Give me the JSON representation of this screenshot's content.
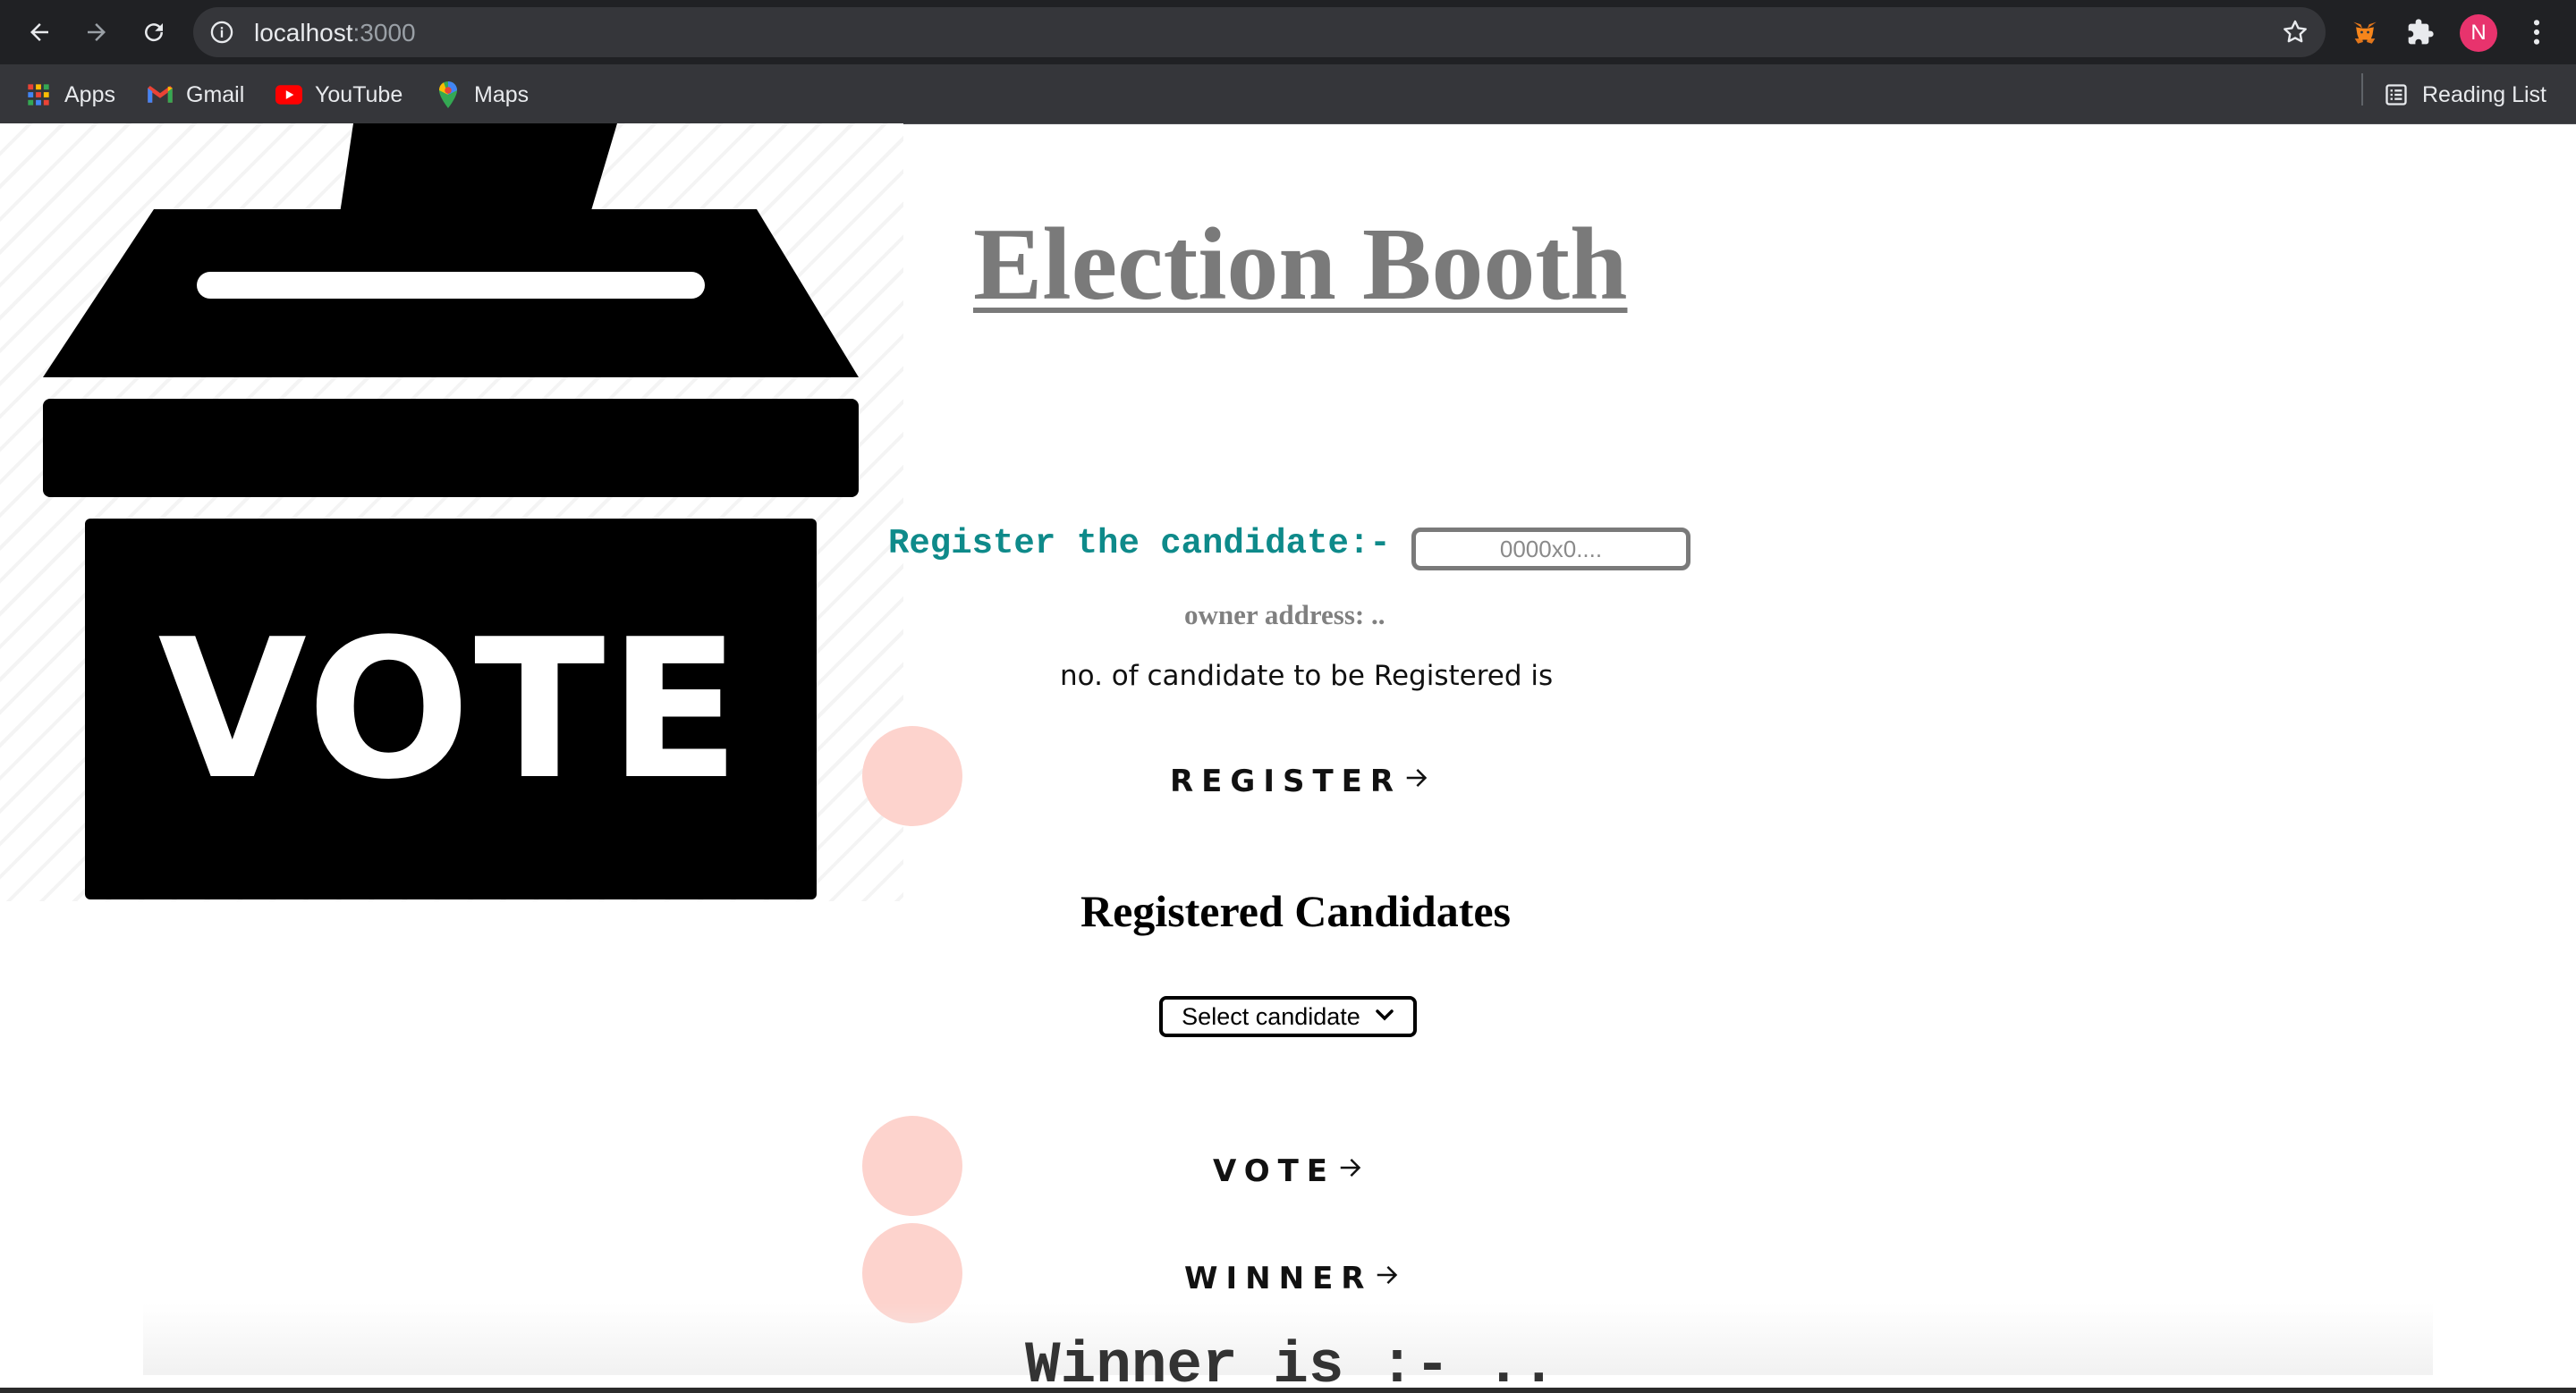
{
  "browser": {
    "url_host": "localhost",
    "url_port": ":3000",
    "profile_initial": "N",
    "bookmarks": [
      {
        "label": "Apps",
        "icon": "apps-grid-icon"
      },
      {
        "label": "Gmail",
        "icon": "gmail-icon"
      },
      {
        "label": "YouTube",
        "icon": "youtube-icon"
      },
      {
        "label": "Maps",
        "icon": "maps-icon"
      }
    ],
    "reading_list": "Reading List"
  },
  "hero": {
    "logo_text": "VOTE"
  },
  "main": {
    "title": "Election Booth",
    "register_label": "Register the candidate:-",
    "address_placeholder": "0000x0....",
    "owner_address": "owner address: ..",
    "candidate_count_text": "no. of candidate to be Registered is",
    "register_button": "REGISTER",
    "registered_heading": "Registered Candidates",
    "select_value": "Select candidate",
    "vote_button": "VOTE",
    "winner_button": "WINNER",
    "winner_text": "Winner is :- .."
  },
  "colors": {
    "accent_teal": "#0e8a8a",
    "circle_pink": "#fdd3cd",
    "title_gray": "#7a7a7a"
  }
}
